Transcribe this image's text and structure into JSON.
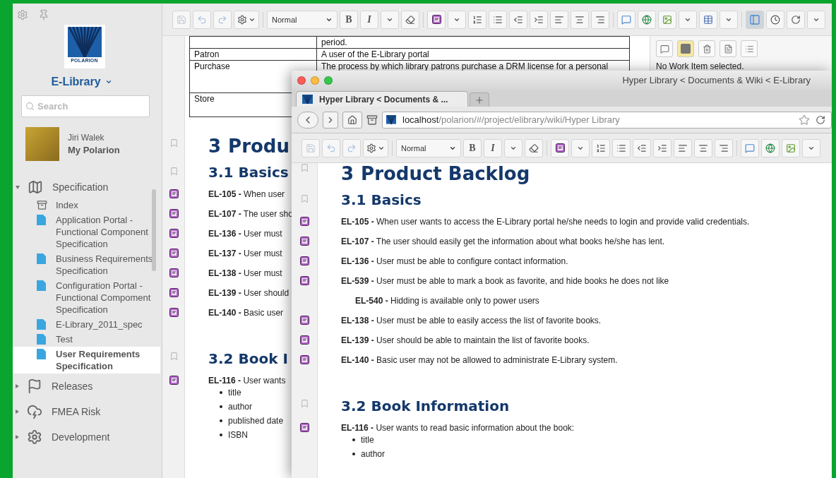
{
  "sidebar": {
    "logo": "POLARION",
    "project": "E-Library",
    "search": {
      "placeholder": "Search"
    },
    "user": {
      "name": "Jiri Walek",
      "link": "My Polarion"
    },
    "tree": [
      {
        "label": "Specification",
        "kind": "specification",
        "expanded": true,
        "selected": false,
        "children": [
          {
            "label": "Index",
            "kind": "index",
            "selected": false
          },
          {
            "label": "Application Portal - Functional Component Specification",
            "kind": "document",
            "selected": false
          },
          {
            "label": "Business Requirements Specification",
            "kind": "document",
            "selected": false
          },
          {
            "label": "Configuration Portal - Functional Compoment Specification",
            "kind": "document",
            "selected": false
          },
          {
            "label": "E-Library_2011_spec",
            "kind": "document",
            "selected": false
          },
          {
            "label": "Test",
            "kind": "document",
            "selected": false
          },
          {
            "label": "User Requirements Specification",
            "kind": "document",
            "selected": true
          }
        ]
      },
      {
        "label": "Releases",
        "kind": "releases",
        "expanded": false,
        "selected": false
      },
      {
        "label": "FMEA Risk",
        "kind": "risk",
        "expanded": false,
        "selected": false
      },
      {
        "label": "Development",
        "kind": "development",
        "expanded": false,
        "selected": false
      }
    ]
  },
  "toolbar": {
    "style": "Normal",
    "bold": "B",
    "italic": "I",
    "panel_toggled": true
  },
  "document": {
    "table": [
      {
        "definition": "period."
      },
      {
        "term": "Patron",
        "definition": "A user of the E-Library portal"
      },
      {
        "term": "Purchase",
        "definition": "The process by which library patrons purchase a DRM license for a personal"
      },
      {
        "term": "Store"
      }
    ],
    "heading": {
      "number": "3",
      "title": "Produ"
    },
    "sections": [
      {
        "number": "3.1",
        "title": "Basics",
        "items": [
          {
            "id": "EL-105 -",
            "text": "When user"
          },
          {
            "id": "EL-107 -",
            "text": "The user sho"
          },
          {
            "id": "EL-136 -",
            "text": "User must"
          },
          {
            "id": "EL-137 -",
            "text": "User must"
          },
          {
            "id": "EL-138 -",
            "text": "User must"
          },
          {
            "id": "EL-139 -",
            "text": "User should"
          },
          {
            "id": "EL-140 -",
            "text": "Basic user"
          }
        ]
      },
      {
        "number": "3.2",
        "title": "Book I",
        "items": [
          {
            "id": "EL-116 -",
            "text": "User wants",
            "bullets": [
              "title",
              "author",
              "published date",
              "ISBN"
            ]
          }
        ]
      }
    ]
  },
  "side_panel": {
    "message": "No Work Item selected."
  },
  "browser": {
    "title": "Hyper Library < Documents & Wiki < E-Library",
    "tab": "Hyper Library < Documents & ...",
    "url": {
      "host": "localhost",
      "path": "/polarion/#/project/elibrary/wiki/Hyper Library"
    },
    "toolbar": {
      "style": "Normal",
      "bold": "B",
      "italic": "I"
    },
    "document": {
      "heading": {
        "number": "3",
        "title": "Product Backlog"
      },
      "sections": [
        {
          "number": "3.1",
          "title": "Basics",
          "items": [
            {
              "id": "EL-105 -",
              "text": "When user wants to access the E-Library portal he/she needs to login and provide valid credentials."
            },
            {
              "id": "EL-107 -",
              "text": "The user should easily get the information about what books he/she has lent."
            },
            {
              "id": "EL-136 -",
              "text": "User must be able to configure contact information."
            },
            {
              "id": "EL-539 -",
              "text": "User must be able to mark a book as favorite, and hide books he does not like",
              "children": [
                {
                  "id": "EL-540 -",
                  "text": "Hidding is available only to power users"
                }
              ]
            },
            {
              "id": "EL-138 -",
              "text": "User must be able to easily access the list of favorite books."
            },
            {
              "id": "EL-139 -",
              "text": "User should be able to maintain the list of favorite books."
            },
            {
              "id": "EL-140 -",
              "text": "Basic user may not be allowed to administrate E-Library system."
            }
          ]
        },
        {
          "number": "3.2",
          "title": "Book Information",
          "items": [
            {
              "id": "EL-116 -",
              "text": "User wants to read basic information about the book:",
              "bullets": [
                "title",
                "author"
              ]
            }
          ]
        }
      ]
    }
  }
}
